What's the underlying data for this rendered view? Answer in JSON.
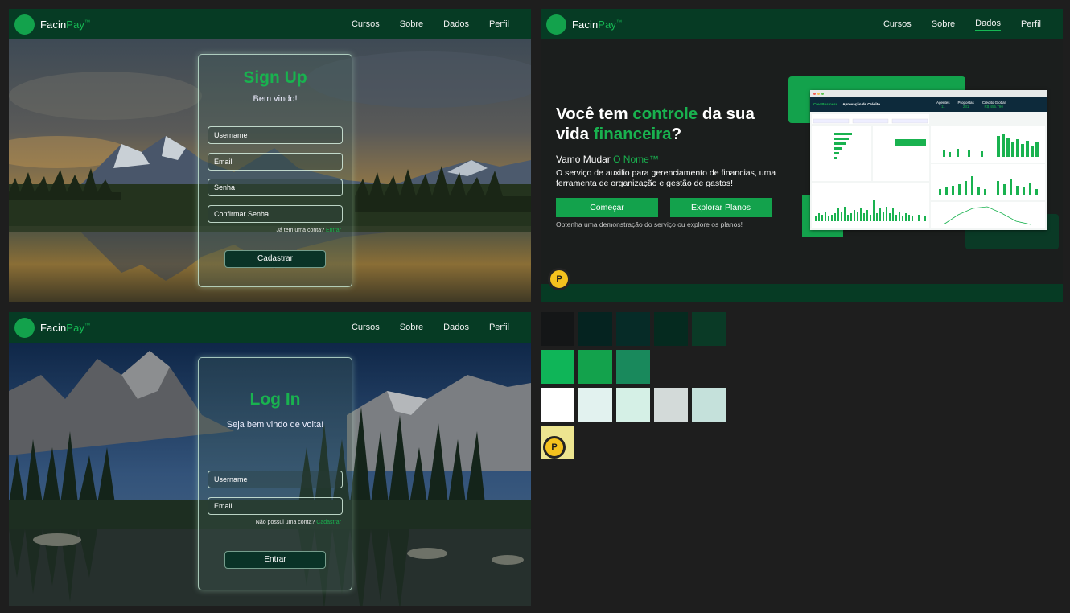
{
  "brand": {
    "prefix": "Facin",
    "highlight": "Pay",
    "tm": "™"
  },
  "nav": {
    "cursos": "Cursos",
    "sobre": "Sobre",
    "dados": "Dados",
    "perfil": "Perfil"
  },
  "signup": {
    "title": "Sign Up",
    "subtitle": "Bem vindo!",
    "username": "Username",
    "email": "Email",
    "senha": "Senha",
    "confirmar": "Confirmar Senha",
    "hint": "Já tem uma conta?",
    "hint_link": "Entrar",
    "button": "Cadastrar"
  },
  "login": {
    "title": "Log In",
    "subtitle": "Seja bem vindo de volta!",
    "username": "Username",
    "email": "Email",
    "hint": "Não possui uma conta?",
    "hint_link": "Cadastrar",
    "button": "Entrar"
  },
  "hero": {
    "title_a": "Você tem ",
    "title_b": "controle",
    "title_c": " da sua",
    "title_d": "vida ",
    "title_e": "financeira",
    "title_f": "?",
    "sub_a": "Vamo Mudar ",
    "sub_b": "O Nome™",
    "desc": "O serviço de auxilio para gerenciamento de financias, uma ferramenta de organização e gestão de gastos!",
    "btn_start": "Começar",
    "btn_plans": "Explorar Planos",
    "note": "Obtenha uma demonstração do serviço ou explore os planos!"
  },
  "dashboard": {
    "brand": "CredBusiness",
    "title": "Aprovação de Crédito",
    "stat1_label": "Agentes",
    "stat1_value": "11",
    "stat2_label": "Propostas",
    "stat2_value": "231",
    "stat3_label": "Crédito Global",
    "stat3_value": "R$ 455.790"
  },
  "badge_letter": "P",
  "palette": {
    "row1": [
      "#141617",
      "#052320",
      "#062b27",
      "#052a1f",
      "#0a3a26"
    ],
    "row2": [
      "#0fb558",
      "#13a24c",
      "#19895c"
    ],
    "row3": [
      "#ffffff",
      "#e2f2ef",
      "#d5f0e6",
      "#d3dad9",
      "#c5e1db"
    ],
    "row4": [
      "#ede590"
    ]
  }
}
